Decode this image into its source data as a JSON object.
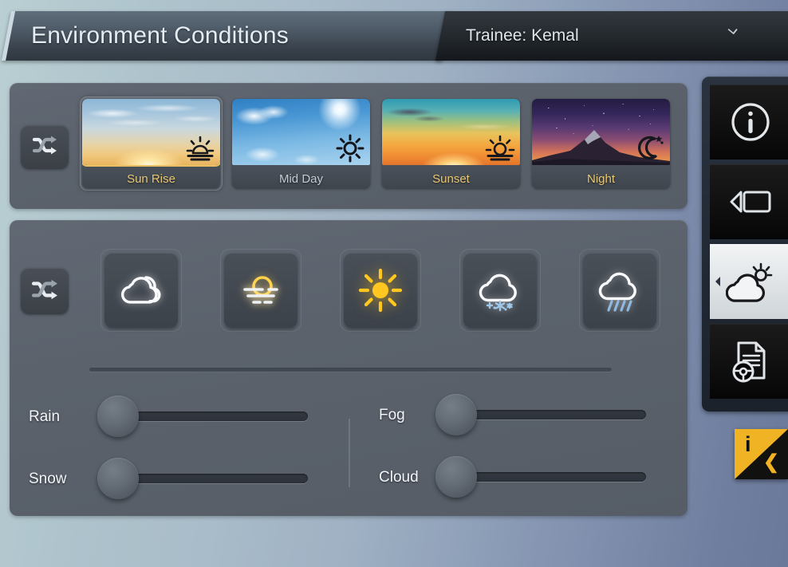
{
  "header": {
    "title": "Environment Conditions",
    "trainee_label": "Trainee: Kemal",
    "caret_icon": "chevron-down-icon"
  },
  "time_of_day": {
    "shuffle_icon": "shuffle-icon",
    "selected": "Sun Rise",
    "cards": [
      {
        "label": "Sun Rise",
        "badge_icon": "sunrise-icon",
        "selected": true,
        "sky": "sky-sunrise"
      },
      {
        "label": "Mid Day",
        "badge_icon": "sun-icon",
        "selected": false,
        "sky": "sky-midday"
      },
      {
        "label": "Sunset",
        "badge_icon": "sunset-icon",
        "selected": false,
        "sky": "sky-sunset"
      },
      {
        "label": "Night",
        "badge_icon": "moon-stars-icon",
        "selected": false,
        "sky": "sky-night"
      }
    ]
  },
  "weather": {
    "shuffle_icon": "shuffle-icon",
    "buttons": [
      {
        "name": "cloudy",
        "icon": "cloudy-icon",
        "color": "#ffffff"
      },
      {
        "name": "fog",
        "icon": "sun-fog-icon",
        "color": "#ffd24a"
      },
      {
        "name": "clear",
        "icon": "sun-icon",
        "color": "#ffc71f"
      },
      {
        "name": "snow",
        "icon": "cloud-snow-icon",
        "color": "#9ec8ea"
      },
      {
        "name": "rain",
        "icon": "cloud-rain-icon",
        "color": "#8fb9e0"
      }
    ]
  },
  "sliders": [
    {
      "label": "Rain",
      "value": 0,
      "min": 0,
      "max": 100
    },
    {
      "label": "Snow",
      "value": 0,
      "min": 0,
      "max": 100
    },
    {
      "label": "Fog",
      "value": 0,
      "min": 0,
      "max": 100
    },
    {
      "label": "Cloud",
      "value": 0,
      "min": 0,
      "max": 100
    }
  ],
  "sidebar": {
    "back_arrow_icon": "chevron-left-icon",
    "items": [
      {
        "name": "info",
        "icon": "info-circle-icon",
        "active": false
      },
      {
        "name": "playback",
        "icon": "video-camera-icon",
        "active": false
      },
      {
        "name": "weather",
        "icon": "cloud-sun-icon",
        "active": true
      },
      {
        "name": "report",
        "icon": "document-wheel-icon",
        "active": false
      }
    ]
  },
  "corner_button": {
    "name": "info-collapse-button",
    "glyph_i": "i",
    "glyph_chevron": "❮",
    "accent_color": "#f0b323"
  },
  "colors": {
    "panel": "#5b626c",
    "selection_gold": "#e8bf63",
    "accent_yellow": "#f0b323",
    "sidebar_dark": "#101010"
  }
}
